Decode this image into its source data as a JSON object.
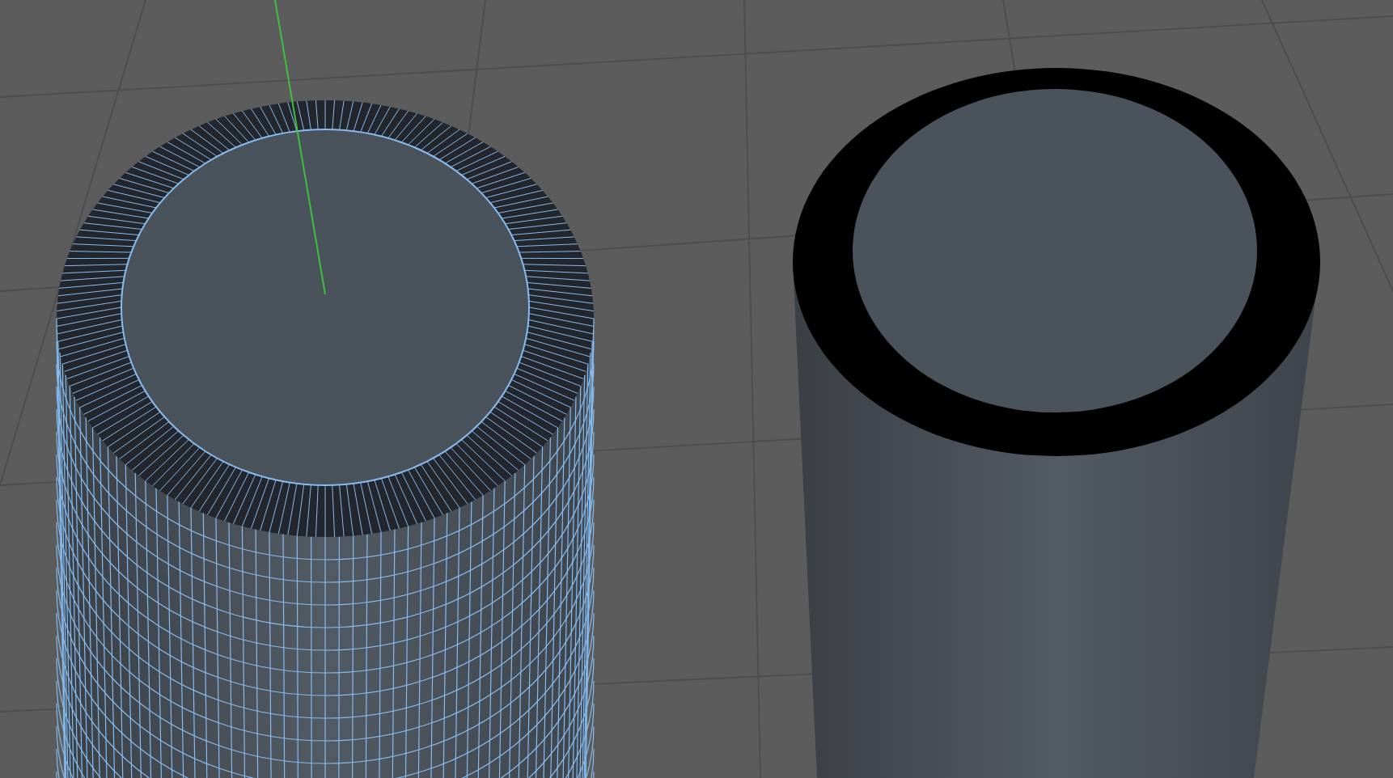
{
  "viewport": {
    "objects": [
      {
        "kind": "tube",
        "selected": true
      },
      {
        "kind": "tube",
        "selected": false
      }
    ]
  }
}
